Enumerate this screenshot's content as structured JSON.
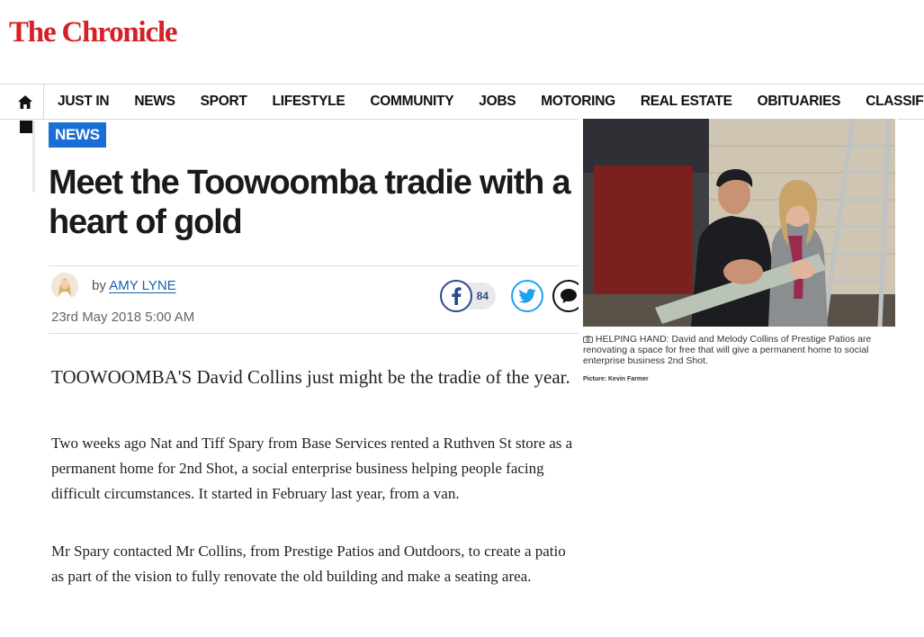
{
  "site": {
    "masthead": "The Chronicle"
  },
  "nav": {
    "home_icon": "home-icon",
    "items": [
      "JUST IN",
      "NEWS",
      "SPORT",
      "LIFESTYLE",
      "COMMUNITY",
      "JOBS",
      "MOTORING",
      "REAL ESTATE",
      "OBITUARIES",
      "CLASSIFIEDS"
    ]
  },
  "article": {
    "category": "NEWS",
    "headline": "Meet the Toowoomba tradie with a heart of gold",
    "byline_prefix": "by",
    "author": "AMY LYNE",
    "date": "23rd May 2018 5:00 AM",
    "lead": "TOOWOOMBA'S David Collins just might be the tradie of the year.",
    "paragraphs": [
      "Two weeks ago Nat and Tiff Spary from Base Services rented a Ruthven St store as a permanent home for 2nd Shot, a social enterprise business helping people facing difficult circumstances. It started in February last year, from a van.",
      "Mr Spary contacted Mr Collins, from Prestige Patios and Outdoors, to create a patio as part of the vision to fully renovate the old building and make a seating area."
    ]
  },
  "share": {
    "facebook_count": "84",
    "icons": [
      "facebook-icon",
      "twitter-icon",
      "comment-icon"
    ]
  },
  "photo": {
    "caption": "HELPING HAND: David and Melody Collins of Prestige Patios are renovating a space for free that will give a permanent home to social enterprise business 2nd Shot.",
    "credit": "Picture: Kevin Farmer"
  },
  "colors": {
    "brand_red": "#d61f26",
    "tag_blue": "#1a6fd6",
    "facebook": "#2b4a8b",
    "twitter": "#1da1f2"
  }
}
